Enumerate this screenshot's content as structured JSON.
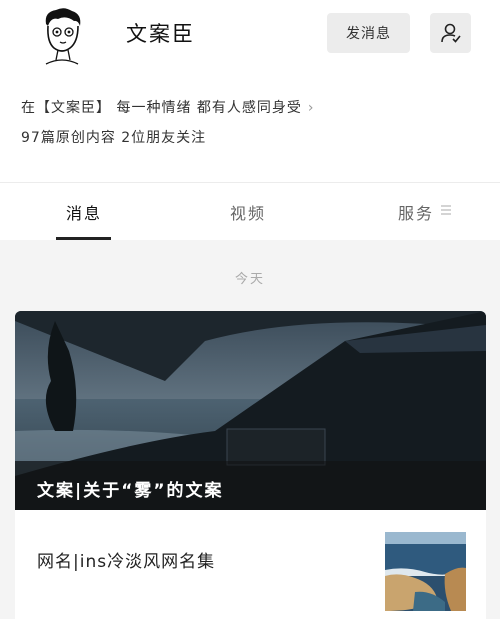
{
  "profile": {
    "name": "文案臣",
    "message_button": "发消息",
    "intro": "在【文案臣】 每一种情绪 都有人感同身受",
    "stats": "97篇原创内容  2位朋友关注"
  },
  "tabs": [
    {
      "label": "消息",
      "active": true
    },
    {
      "label": "视频",
      "active": false
    },
    {
      "label": "服务",
      "active": false
    }
  ],
  "feed": {
    "date_label": "今天",
    "cover_article_title": "文案|关于“雾”的文案",
    "second_article_title": "网名|ins冷淡风网名集"
  },
  "icons": {
    "avatar": "cartoon-face-avatar",
    "follow": "user-check-icon",
    "intro_arrow": "chevron-right-icon",
    "tab_menu": "menu-lines-icon"
  }
}
